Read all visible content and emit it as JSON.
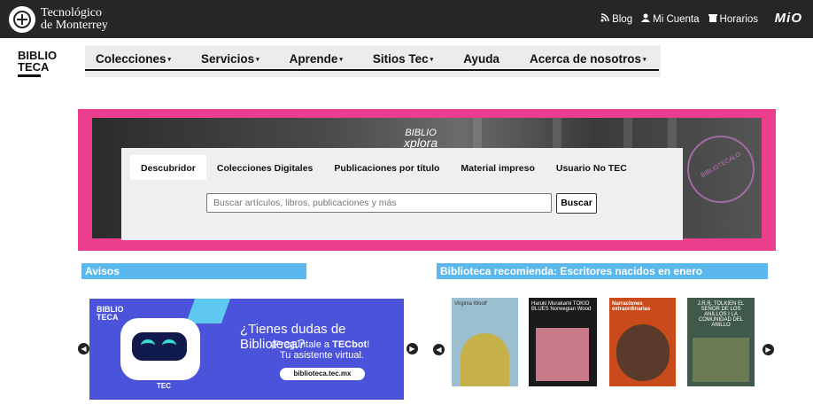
{
  "topbar": {
    "brand_line1": "Tecnológico",
    "brand_line2": "de Monterrey",
    "links": [
      {
        "label": "Blog",
        "icon": "rss-icon"
      },
      {
        "label": "Mi Cuenta",
        "icon": "user-icon"
      },
      {
        "label": "Horarios",
        "icon": "building-icon"
      }
    ],
    "mio": "MiO",
    "background": "#262626"
  },
  "navbar": {
    "logo_line1": "BIBLIO",
    "logo_line2": "TECA",
    "items": [
      {
        "label": "Colecciones",
        "has_dropdown": true
      },
      {
        "label": "Servicios",
        "has_dropdown": true
      },
      {
        "label": "Aprende",
        "has_dropdown": true
      },
      {
        "label": "Sitios Tec",
        "has_dropdown": true
      },
      {
        "label": "Ayuda",
        "has_dropdown": false
      },
      {
        "label": "Acerca de nosotros",
        "has_dropdown": true
      }
    ],
    "caret": "▾"
  },
  "hero": {
    "explora_line1": "BIBLIO",
    "explora_line2": "xplora",
    "stamp_text": "BIBLIOTECALO",
    "border_color": "#ec3e8c",
    "tabs": [
      {
        "label": "Descubridor",
        "active": true
      },
      {
        "label": "Colecciones Digitales",
        "active": false
      },
      {
        "label": "Publicaciones por título",
        "active": false
      },
      {
        "label": "Material impreso",
        "active": false
      },
      {
        "label": "Usuario No TEC",
        "active": false
      }
    ],
    "search_placeholder": "Buscar artículos, libros, publicaciones y más",
    "search_button": "Buscar"
  },
  "avisos": {
    "title": "Avisos",
    "banner": {
      "logo_line1": "BIBLIO",
      "logo_line2": "TECA",
      "robot_badge": "TEC",
      "heading": "¿Tienes dudas de Biblioteca?",
      "line2_prefix": "¡Pregúntale a ",
      "line2_bold": "TECbot",
      "line2_suffix": "!",
      "line3": "Tu asistente virtual.",
      "url": "biblioteca.tec.mx"
    },
    "prev_icon": "chevron-left-icon",
    "next_icon": "chevron-right-icon"
  },
  "recomienda": {
    "title": "Biblioteca recomienda: Escritores nacidos en enero",
    "books": [
      {
        "title": "Virginia Woolf",
        "color": "#9bbfcf"
      },
      {
        "title": "Haruki Murakami TOKIO BLUES Norwegian Wood",
        "color": "#1a1a1a"
      },
      {
        "title": "Narraciones extraordinarias",
        "color": "#c94a1a"
      },
      {
        "title": "J.R.R. TOLKIEN EL SEÑOR DE LOS ANILLOS I LA COMUNIDAD DEL ANILLO",
        "color": "#3f5a4a"
      }
    ],
    "accent": "#5bb8ec"
  }
}
